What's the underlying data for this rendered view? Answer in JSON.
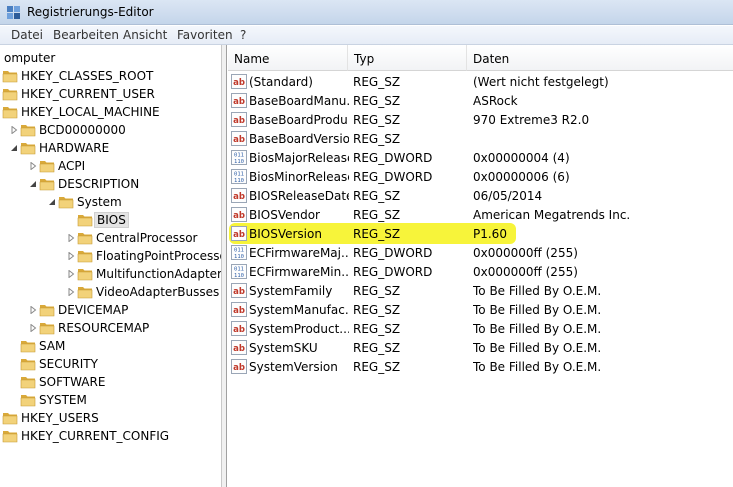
{
  "window": {
    "title": "Registrierungs-Editor"
  },
  "menu": [
    "Datei",
    "Bearbeiten",
    "Ansicht",
    "Favoriten",
    "?"
  ],
  "tree": [
    {
      "label": "omputer",
      "level": "root",
      "expander": "none",
      "folder": false
    },
    {
      "label": "HKEY_CLASSES_ROOT",
      "level": 0,
      "expander": "none",
      "folder": true
    },
    {
      "label": "HKEY_CURRENT_USER",
      "level": 0,
      "expander": "none",
      "folder": true
    },
    {
      "label": "HKEY_LOCAL_MACHINE",
      "level": 0,
      "expander": "none",
      "folder": true
    },
    {
      "label": "BCD00000000",
      "level": 1,
      "expander": "collapsed",
      "folder": true
    },
    {
      "label": "HARDWARE",
      "level": 1,
      "expander": "expanded",
      "folder": true
    },
    {
      "label": "ACPI",
      "level": 2,
      "expander": "collapsed",
      "folder": true
    },
    {
      "label": "DESCRIPTION",
      "level": 2,
      "expander": "expanded",
      "folder": true
    },
    {
      "label": "System",
      "level": 3,
      "expander": "expanded",
      "folder": true
    },
    {
      "label": "BIOS",
      "level": 4,
      "expander": "none",
      "folder": true,
      "selected": true
    },
    {
      "label": "CentralProcessor",
      "level": 4,
      "expander": "collapsed",
      "folder": true
    },
    {
      "label": "FloatingPointProcessor",
      "level": 4,
      "expander": "collapsed",
      "folder": true
    },
    {
      "label": "MultifunctionAdapter",
      "level": 4,
      "expander": "collapsed",
      "folder": true
    },
    {
      "label": "VideoAdapterBusses",
      "level": 4,
      "expander": "collapsed",
      "folder": true
    },
    {
      "label": "DEVICEMAP",
      "level": 2,
      "expander": "collapsed",
      "folder": true
    },
    {
      "label": "RESOURCEMAP",
      "level": 2,
      "expander": "collapsed",
      "folder": true
    },
    {
      "label": "SAM",
      "level": 1,
      "expander": "none",
      "folder": true
    },
    {
      "label": "SECURITY",
      "level": 1,
      "expander": "none",
      "folder": true
    },
    {
      "label": "SOFTWARE",
      "level": 1,
      "expander": "none",
      "folder": true
    },
    {
      "label": "SYSTEM",
      "level": 1,
      "expander": "none",
      "folder": true
    },
    {
      "label": "HKEY_USERS",
      "level": 0,
      "expander": "none",
      "folder": true
    },
    {
      "label": "HKEY_CURRENT_CONFIG",
      "level": 0,
      "expander": "none",
      "folder": true
    }
  ],
  "columns": {
    "name": "Name",
    "type": "Typ",
    "data": "Daten"
  },
  "values": [
    {
      "name": "(Standard)",
      "type": "REG_SZ",
      "data": "(Wert nicht festgelegt)",
      "icon": "string"
    },
    {
      "name": "BaseBoardManu...",
      "type": "REG_SZ",
      "data": "ASRock",
      "icon": "string"
    },
    {
      "name": "BaseBoardProdu...",
      "type": "REG_SZ",
      "data": "970 Extreme3 R2.0",
      "icon": "string"
    },
    {
      "name": "BaseBoardVersion",
      "type": "REG_SZ",
      "data": "",
      "icon": "string"
    },
    {
      "name": "BiosMajorRelease",
      "type": "REG_DWORD",
      "data": "0x00000004 (4)",
      "icon": "dword"
    },
    {
      "name": "BiosMinorRelease",
      "type": "REG_DWORD",
      "data": "0x00000006 (6)",
      "icon": "dword"
    },
    {
      "name": "BIOSReleaseDate",
      "type": "REG_SZ",
      "data": "06/05/2014",
      "icon": "string"
    },
    {
      "name": "BIOSVendor",
      "type": "REG_SZ",
      "data": "American Megatrends Inc.",
      "icon": "string"
    },
    {
      "name": "BIOSVersion",
      "type": "REG_SZ",
      "data": "P1.60",
      "icon": "string",
      "highlighted": true
    },
    {
      "name": "ECFirmwareMaj...",
      "type": "REG_DWORD",
      "data": "0x000000ff (255)",
      "icon": "dword"
    },
    {
      "name": "ECFirmwareMin...",
      "type": "REG_DWORD",
      "data": "0x000000ff (255)",
      "icon": "dword"
    },
    {
      "name": "SystemFamily",
      "type": "REG_SZ",
      "data": "To Be Filled By O.E.M.",
      "icon": "string"
    },
    {
      "name": "SystemManufac...",
      "type": "REG_SZ",
      "data": "To Be Filled By O.E.M.",
      "icon": "string"
    },
    {
      "name": "SystemProduct...",
      "type": "REG_SZ",
      "data": "To Be Filled By O.E.M.",
      "icon": "string"
    },
    {
      "name": "SystemSKU",
      "type": "REG_SZ",
      "data": "To Be Filled By O.E.M.",
      "icon": "string"
    },
    {
      "name": "SystemVersion",
      "type": "REG_SZ",
      "data": "To Be Filled By O.E.M.",
      "icon": "string"
    }
  ],
  "colors": {
    "highlight": "#f7f43a",
    "string_icon": "#c0392b",
    "dword_icon": "#2e5fa8",
    "folder": "#e9c46a"
  }
}
